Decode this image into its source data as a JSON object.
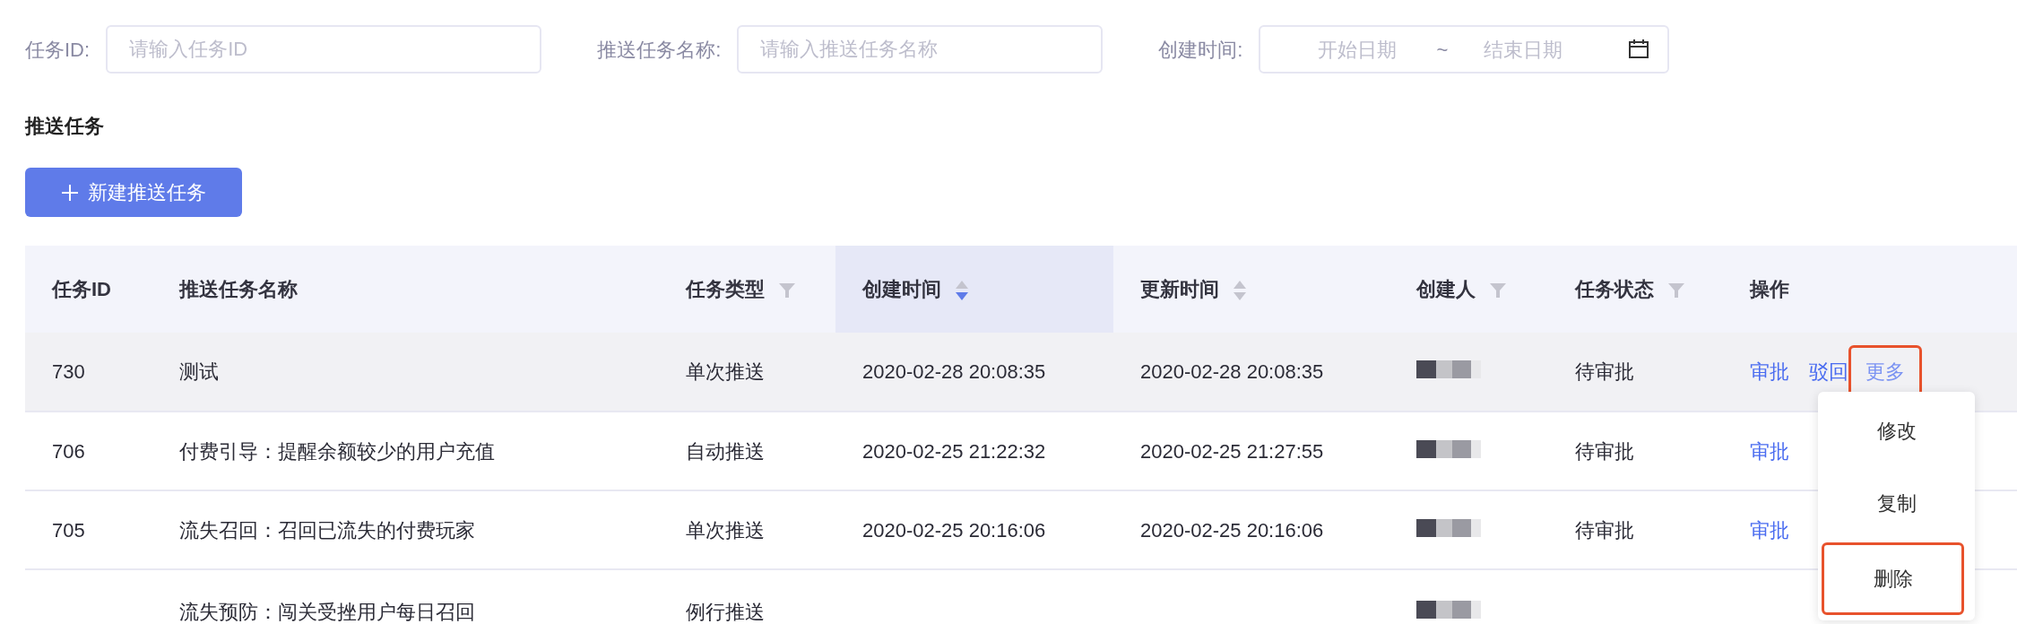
{
  "filters": [
    {
      "kind": "text",
      "label": "任务ID:",
      "placeholder": "请输入任务ID"
    },
    {
      "kind": "text",
      "label": "推送任务名称:",
      "placeholder": "请输入推送任务名称"
    },
    {
      "kind": "daterange",
      "label": "创建时间:",
      "start_placeholder": "开始日期",
      "separator": "~",
      "end_placeholder": "结束日期"
    }
  ],
  "section_title": "推送任务",
  "new_button": {
    "label": "新建推送任务"
  },
  "columns": [
    {
      "title": "任务ID",
      "filter": false,
      "selected": false
    },
    {
      "title": "推送任务名称",
      "filter": false,
      "selected": false
    },
    {
      "title": "任务类型",
      "filter": true,
      "selected": false
    },
    {
      "title": "创建时间",
      "filter": false,
      "sortable": true,
      "sorted_desc": true,
      "selected": true
    },
    {
      "title": "更新时间",
      "filter": false,
      "sortable": true,
      "sorted_desc": false,
      "selected": false
    },
    {
      "title": "创建人",
      "filter": true,
      "selected": false
    },
    {
      "title": "任务状态",
      "filter": true,
      "selected": false
    },
    {
      "title": "操作",
      "filter": false,
      "selected": false
    }
  ],
  "rows": [
    {
      "hovered": true,
      "id": "730",
      "name": "测试",
      "type": "单次推送",
      "created": "2020-02-28 20:08:35",
      "updated": "2020-02-28 20:08:35",
      "creator_redacted": true,
      "status": "待审批",
      "actions": [
        {
          "label": "审批",
          "highlighted": false
        },
        {
          "label": "驳回",
          "highlighted": false
        },
        {
          "label": "更多",
          "highlighted": true,
          "expanded": true
        }
      ]
    },
    {
      "hovered": false,
      "id": "706",
      "name": "付费引导：提醒余额较少的用户充值",
      "type": "自动推送",
      "created": "2020-02-25 21:22:32",
      "updated": "2020-02-25 21:27:55",
      "creator_redacted": true,
      "status": "待审批",
      "actions": [
        {
          "label": "审批",
          "highlighted": false
        }
      ]
    },
    {
      "hovered": false,
      "id": "705",
      "name": "流失召回：召回已流失的付费玩家",
      "type": "单次推送",
      "created": "2020-02-25 20:16:06",
      "updated": "2020-02-25 20:16:06",
      "creator_redacted": true,
      "status": "待审批",
      "actions": [
        {
          "label": "审批",
          "highlighted": false
        }
      ]
    },
    {
      "hovered": false,
      "name": "流失预防：闯关受挫用户每日召回",
      "type": "例行推送",
      "creator_redacted": true,
      "actions": []
    }
  ],
  "more_menu": {
    "items": [
      {
        "label": "修改",
        "highlighted": false
      },
      {
        "label": "复制",
        "highlighted": false
      },
      {
        "label": "删除",
        "highlighted": true
      }
    ]
  }
}
